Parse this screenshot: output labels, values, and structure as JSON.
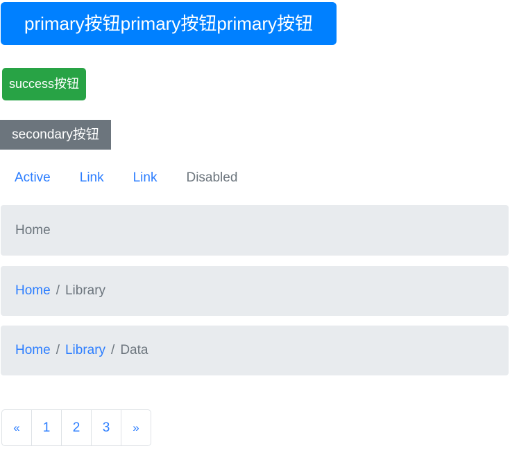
{
  "colors": {
    "primary": "#0080ff",
    "success": "#28a345",
    "secondary": "#6c757d",
    "link": "#2b7dff",
    "muted": "#6c757d",
    "breadcrumb_bg": "#e8ebee",
    "border": "#dee2e6"
  },
  "buttons": {
    "primary_label": "primary按钮primary按钮primary按钮",
    "success_label": "success按钮",
    "secondary_label": "secondary按钮"
  },
  "nav": {
    "items": [
      {
        "label": "Active",
        "state": "active"
      },
      {
        "label": "Link",
        "state": "link"
      },
      {
        "label": "Link",
        "state": "link"
      },
      {
        "label": "Disabled",
        "state": "disabled"
      }
    ]
  },
  "breadcrumbs": [
    {
      "items": [
        {
          "label": "Home",
          "active": true
        }
      ]
    },
    {
      "items": [
        {
          "label": "Home",
          "active": false
        },
        {
          "label": "Library",
          "active": true
        }
      ],
      "separator": "/"
    },
    {
      "items": [
        {
          "label": "Home",
          "active": false
        },
        {
          "label": "Library",
          "active": false
        },
        {
          "label": "Data",
          "active": true
        }
      ],
      "separator": "/"
    }
  ],
  "separator": "/",
  "pagination": {
    "prev_label": "«",
    "next_label": "»",
    "pages": [
      "1",
      "2",
      "3"
    ]
  }
}
